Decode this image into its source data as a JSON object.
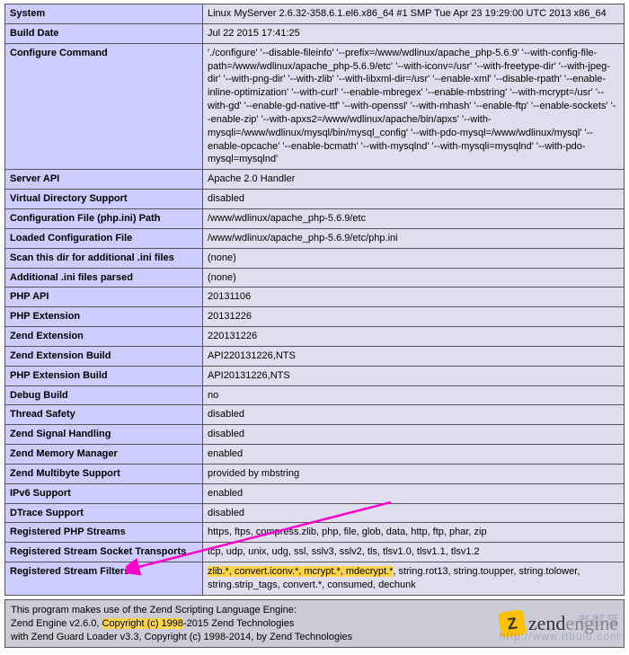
{
  "rows": [
    {
      "key": "System",
      "val": "Linux MyServer 2.6.32-358.6.1.el6.x86_64 #1 SMP Tue Apr 23 19:29:00 UTC 2013 x86_64"
    },
    {
      "key": "Build Date",
      "val": "Jul 22 2015 17:41:25"
    },
    {
      "key": "Configure Command",
      "val": " './configure'  '--disable-fileinfo' '--prefix=/www/wdlinux/apache_php-5.6.9' '--with-config-file-path=/www/wdlinux/apache_php-5.6.9/etc' '--with-iconv=/usr' '--with-freetype-dir' '--with-jpeg-dir' '--with-png-dir' '--with-zlib' '--with-libxml-dir=/usr' '--enable-xml' '--disable-rpath' '--enable-inline-optimization' '--with-curl' '--enable-mbregex' '--enable-mbstring' '--with-mcrypt=/usr' '--with-gd' '--enable-gd-native-ttf' '--with-openssl' '--with-mhash' '--enable-ftp' '--enable-sockets' '--enable-zip' '--with-apxs2=/www/wdlinux/apache/bin/apxs' '--with-mysqli=/www/wdlinux/mysql/bin/mysql_config' '--with-pdo-mysql=/www/wdlinux/mysql' '--enable-opcache' '--enable-bcmath' '--with-mysqlnd' '--with-mysqli=mysqlnd' '--with-pdo-mysql=mysqlnd'"
    },
    {
      "key": "Server API",
      "val": "Apache 2.0 Handler"
    },
    {
      "key": "Virtual Directory Support",
      "val": "disabled"
    },
    {
      "key": "Configuration File (php.ini) Path",
      "val": "/www/wdlinux/apache_php-5.6.9/etc"
    },
    {
      "key": "Loaded Configuration File",
      "val": "/www/wdlinux/apache_php-5.6.9/etc/php.ini"
    },
    {
      "key": "Scan this dir for additional .ini files",
      "val": "(none)"
    },
    {
      "key": "Additional .ini files parsed",
      "val": "(none)"
    },
    {
      "key": "PHP API",
      "val": "20131106"
    },
    {
      "key": "PHP Extension",
      "val": "20131226"
    },
    {
      "key": "Zend Extension",
      "val": "220131226"
    },
    {
      "key": "Zend Extension Build",
      "val": "API220131226,NTS"
    },
    {
      "key": "PHP Extension Build",
      "val": "API20131226,NTS"
    },
    {
      "key": "Debug Build",
      "val": "no"
    },
    {
      "key": "Thread Safety",
      "val": "disabled"
    },
    {
      "key": "Zend Signal Handling",
      "val": "disabled"
    },
    {
      "key": "Zend Memory Manager",
      "val": "enabled"
    },
    {
      "key": "Zend Multibyte Support",
      "val": "provided by mbstring"
    },
    {
      "key": "IPv6 Support",
      "val": "enabled"
    },
    {
      "key": "DTrace Support",
      "val": "disabled"
    },
    {
      "key": "Registered PHP Streams",
      "val": "https, ftps, compress.zlib, php, file, glob, data, http, ftp, phar, zip"
    },
    {
      "key": "Registered Stream Socket Transports",
      "val": "tcp, udp, unix, udg, ssl, sslv3, sslv2, tls, tlsv1.0, tlsv1.1, tlsv1.2"
    },
    {
      "key": "Registered Stream Filters",
      "val_prefix_hl": "zlib.*, convert.iconv.*, mcrypt.*, mdecrypt.*",
      "val_rest": ", string.rot13, string.toupper, string.tolower, string.strip_tags, convert.*, consumed, dechunk"
    }
  ],
  "footer": {
    "line1": "This program makes use of the Zend Scripting Language Engine:",
    "line2_pre": "Zend Engine v2.6.0, ",
    "line2_hl": "Copyright (c) 1998",
    "line2_post": "-2015 Zend Technologies",
    "line3": "    with Zend Guard Loader v3.3, Copyright (c) 1998-2014, by Zend Technologies"
  },
  "logo": {
    "zend": "zend",
    "engine": "engine"
  },
  "watermark": {
    "title": "老部落",
    "url": "http://www.itbulu.com"
  }
}
